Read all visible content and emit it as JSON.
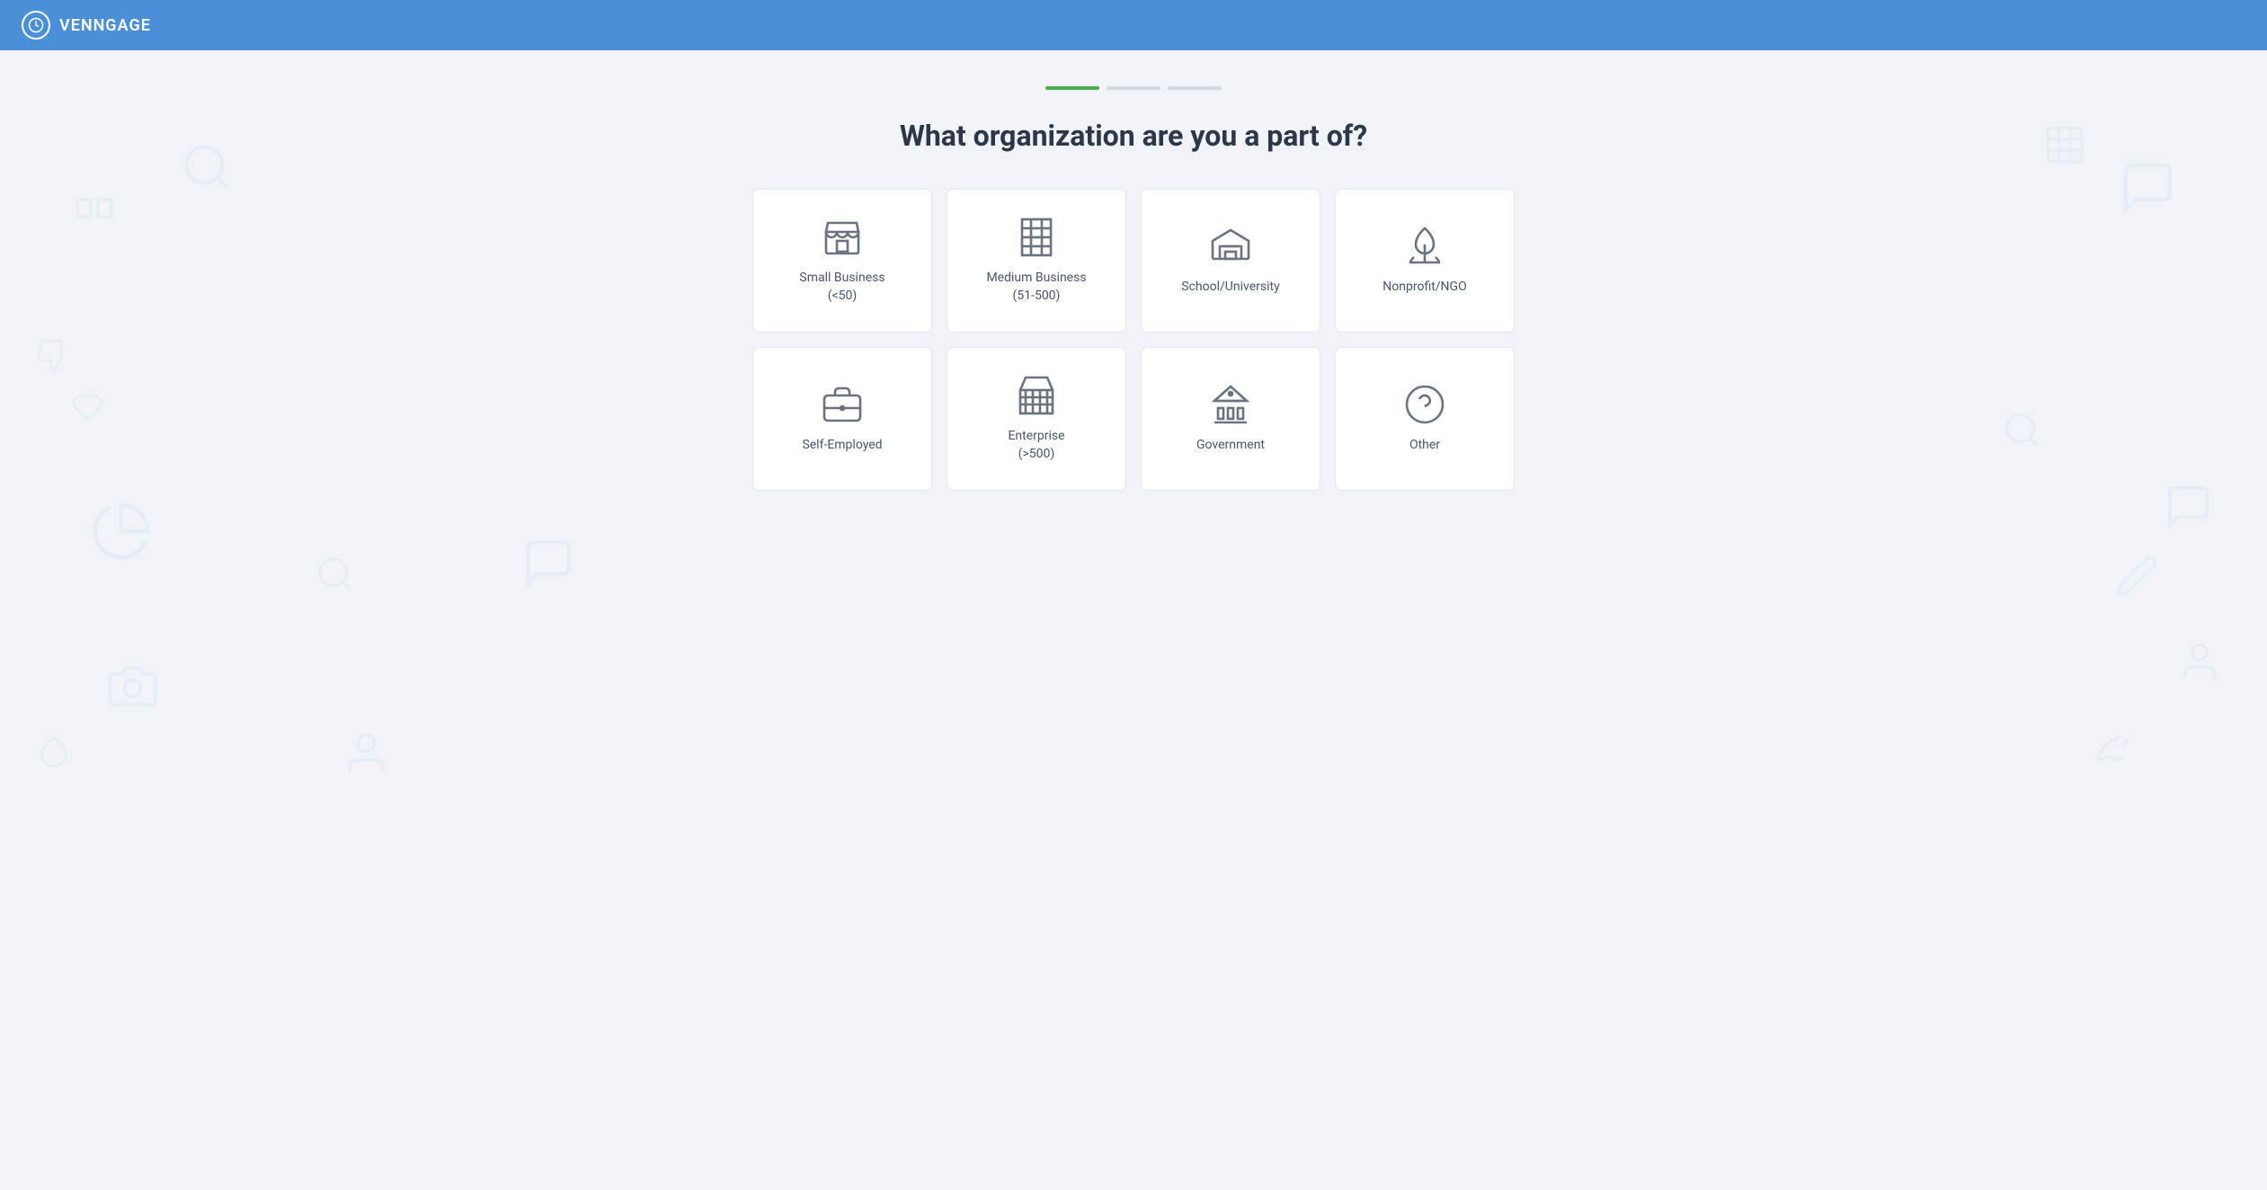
{
  "header": {
    "logo_text": "VENNGAGE"
  },
  "progress": {
    "steps": [
      {
        "id": "step1",
        "state": "active"
      },
      {
        "id": "step2",
        "state": "inactive"
      },
      {
        "id": "step3",
        "state": "inactive"
      }
    ]
  },
  "page": {
    "question": "What organization are you a part of?"
  },
  "options": [
    {
      "id": "small-business",
      "label": "Small Business\n(<50)",
      "label_line1": "Small Business",
      "label_line2": "(<50)",
      "icon": "store"
    },
    {
      "id": "medium-business",
      "label": "Medium Business\n(51-500)",
      "label_line1": "Medium Business",
      "label_line2": "(51-500)",
      "icon": "building"
    },
    {
      "id": "school-university",
      "label": "School/University",
      "label_line1": "School/University",
      "label_line2": "",
      "icon": "school"
    },
    {
      "id": "nonprofit-ngo",
      "label": "Nonprofit/NGO",
      "label_line1": "Nonprofit/NGO",
      "label_line2": "",
      "icon": "nonprofit"
    },
    {
      "id": "self-employed",
      "label": "Self-Employed",
      "label_line1": "Self-Employed",
      "label_line2": "",
      "icon": "briefcase"
    },
    {
      "id": "enterprise",
      "label": "Enterprise\n(>500)",
      "label_line1": "Enterprise",
      "label_line2": "(>500)",
      "icon": "enterprise"
    },
    {
      "id": "government",
      "label": "Government",
      "label_line1": "Government",
      "label_line2": "",
      "icon": "government"
    },
    {
      "id": "other",
      "label": "Other",
      "label_line1": "Other",
      "label_line2": "",
      "icon": "other"
    }
  ]
}
